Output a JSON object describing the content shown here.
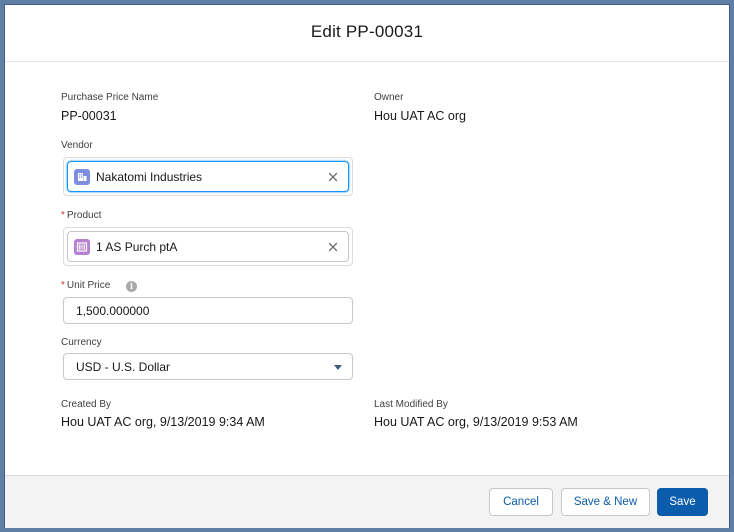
{
  "modal": {
    "title": "Edit PP-00031"
  },
  "fields": {
    "purchase_price_name": {
      "label": "Purchase Price Name",
      "value": "PP-00031"
    },
    "owner": {
      "label": "Owner",
      "value": "Hou UAT AC org"
    },
    "vendor": {
      "label": "Vendor",
      "value": "Nakatomi Industries",
      "icon": "account-icon"
    },
    "product": {
      "label": "Product",
      "required_marker": "*",
      "value": "1 AS Purch ptA",
      "icon": "product-icon"
    },
    "unit_price": {
      "label": "Unit Price",
      "required_marker": "*",
      "value": "1,500.000000",
      "info_icon": "i"
    },
    "currency": {
      "label": "Currency",
      "value": "USD - U.S. Dollar"
    },
    "created_by": {
      "label": "Created By",
      "value": "Hou UAT AC org, 9/13/2019 9:34 AM"
    },
    "last_modified_by": {
      "label": "Last Modified By",
      "value": "Hou UAT AC org, 9/13/2019 9:53 AM"
    }
  },
  "footer": {
    "cancel_label": "Cancel",
    "save_new_label": "Save & New",
    "save_label": "Save"
  },
  "colors": {
    "brand": "#0b5cab",
    "required": "#c23934",
    "vendor_icon": "#7f8de1",
    "product_icon": "#b781d3",
    "focus": "#1b96ff"
  }
}
